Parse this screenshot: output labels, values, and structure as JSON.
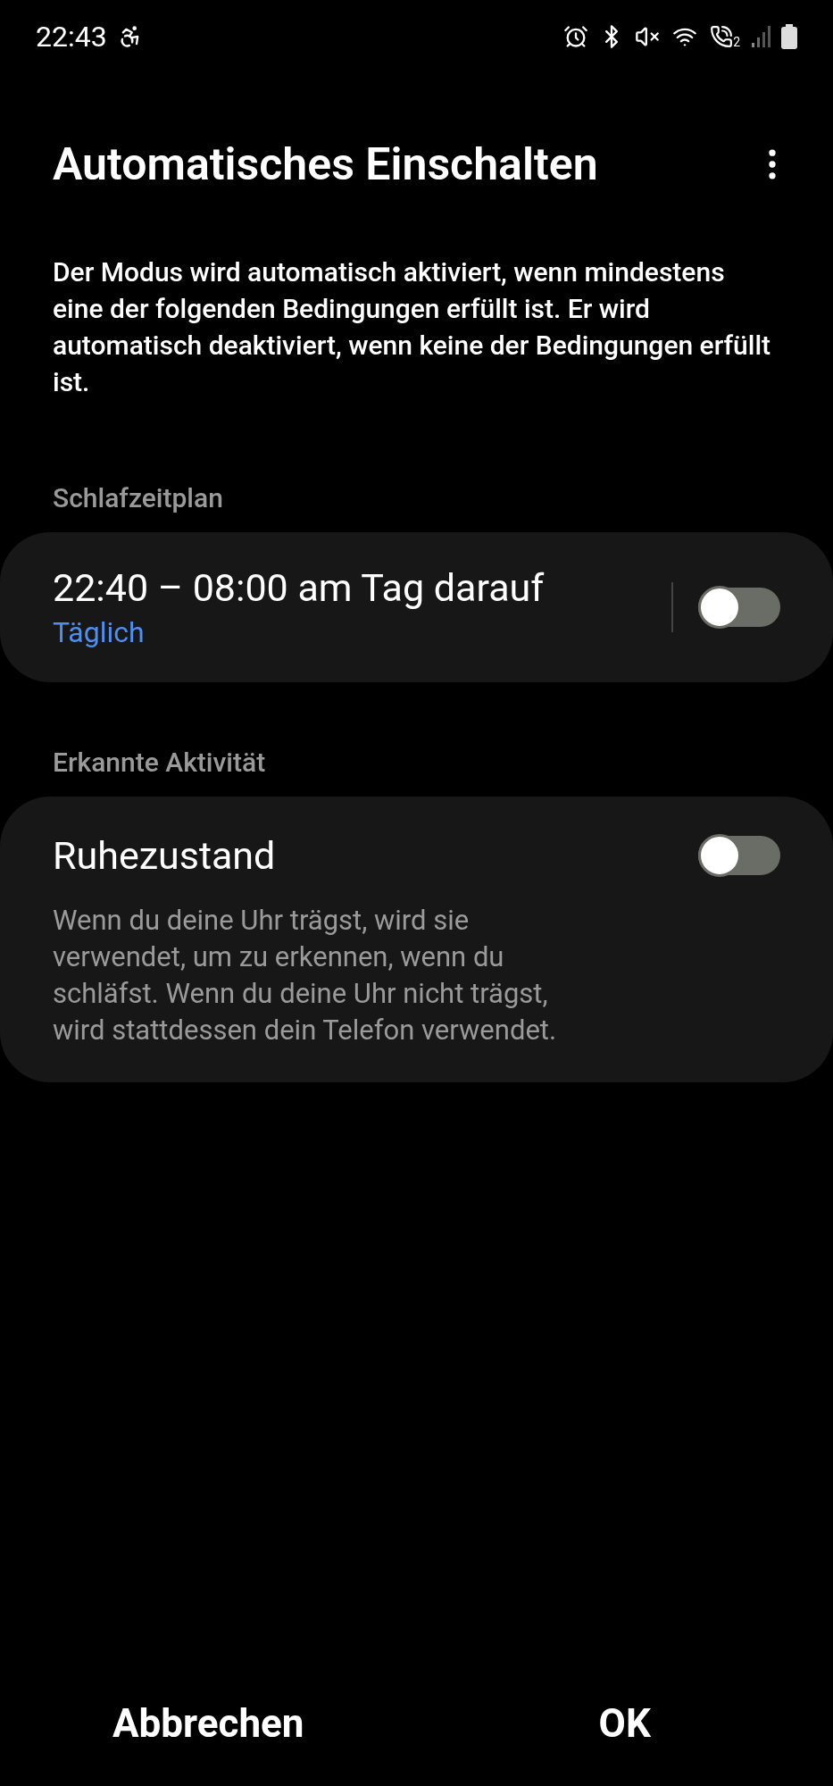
{
  "status_bar": {
    "time": "22:43",
    "call_sim": "2"
  },
  "header": {
    "title": "Automatisches Einschalten"
  },
  "description": "Der Modus wird automatisch aktiviert, wenn mindestens eine der folgenden Bedingungen erfüllt ist. Er wird automatisch deaktiviert, wenn keine der Bedingungen erfüllt ist.",
  "sections": [
    {
      "label": "Schlafzeitplan",
      "item": {
        "kind": "schedule",
        "title": "22:40 – 08:00 am Tag darauf",
        "subtitle": "Täglich",
        "on": false
      }
    },
    {
      "label": "Erkannte Aktivität",
      "item": {
        "kind": "activity",
        "title": "Ruhezustand",
        "description": "Wenn du deine Uhr trägst, wird sie verwendet, um zu erkennen, wenn du schläfst. Wenn du deine Uhr nicht trägst, wird stattdessen dein Telefon verwendet.",
        "on": false
      }
    }
  ],
  "buttons": [
    {
      "label": "Abbrechen"
    },
    {
      "label": "OK"
    }
  ]
}
